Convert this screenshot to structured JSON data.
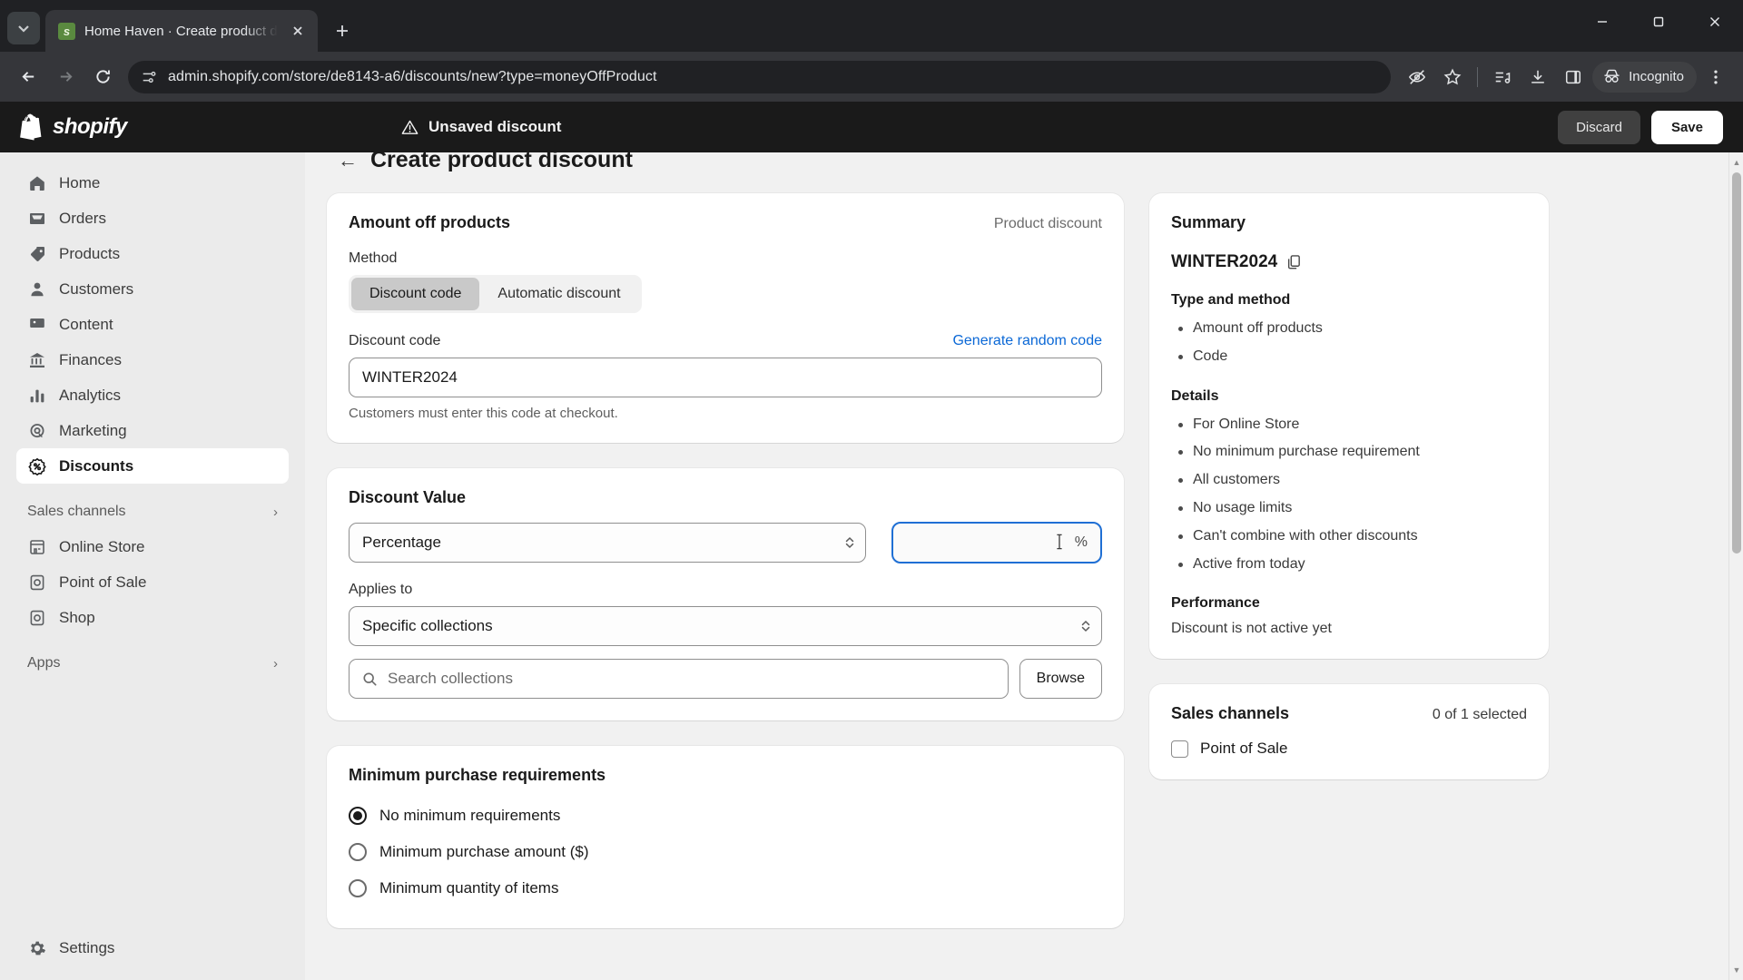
{
  "browser": {
    "tab": {
      "title": "Home Haven · Create product d",
      "favicon_letter": "s"
    },
    "new_tab_label": "+",
    "url": "admin.shopify.com/store/de8143-a6/discounts/new?type=moneyOffProduct",
    "incognito_label": "Incognito",
    "window": {
      "minimize": "–",
      "maximize": "□",
      "close": "✕"
    }
  },
  "shop_header": {
    "brand": "shopify",
    "unsaved_label": "Unsaved discount",
    "discard_label": "Discard",
    "save_label": "Save"
  },
  "sidebar": {
    "items": [
      {
        "label": "Home",
        "icon": "home-icon"
      },
      {
        "label": "Orders",
        "icon": "orders-icon"
      },
      {
        "label": "Products",
        "icon": "products-tag-icon"
      },
      {
        "label": "Customers",
        "icon": "customers-icon"
      },
      {
        "label": "Content",
        "icon": "content-icon"
      },
      {
        "label": "Finances",
        "icon": "finances-bank-icon"
      },
      {
        "label": "Analytics",
        "icon": "analytics-bars-icon"
      },
      {
        "label": "Marketing",
        "icon": "marketing-target-icon"
      },
      {
        "label": "Discounts",
        "icon": "discounts-badge-icon"
      }
    ],
    "sales_channels_group": "Sales channels",
    "sales_channels": [
      {
        "label": "Online Store",
        "icon": "online-store-icon"
      },
      {
        "label": "Point of Sale",
        "icon": "point-of-sale-icon"
      },
      {
        "label": "Shop",
        "icon": "shop-bag-icon"
      }
    ],
    "apps_group": "Apps",
    "settings": {
      "label": "Settings",
      "icon": "gear-icon"
    }
  },
  "page": {
    "title": "Create product discount",
    "back_label": "←"
  },
  "amount_off_card": {
    "title": "Amount off products",
    "badge": "Product discount",
    "method_label": "Method",
    "methods": [
      {
        "label": "Discount code",
        "selected": true
      },
      {
        "label": "Automatic discount",
        "selected": false
      }
    ],
    "code_label": "Discount code",
    "generate_link": "Generate random code",
    "code_value": "WINTER2024",
    "code_placeholder": "",
    "help_text": "Customers must enter this code at checkout."
  },
  "discount_value_card": {
    "title": "Discount Value",
    "type_value": "Percentage",
    "amount_value": "",
    "amount_placeholder": "",
    "percent_suffix": "%",
    "applies_to_label": "Applies to",
    "applies_to_value": "Specific collections",
    "search_placeholder": "Search collections",
    "browse_label": "Browse"
  },
  "minimum_card": {
    "title": "Minimum purchase requirements",
    "options": [
      {
        "label": "No minimum requirements",
        "selected": true
      },
      {
        "label": "Minimum purchase amount ($)",
        "selected": false
      },
      {
        "label": "Minimum quantity of items",
        "selected": false
      }
    ]
  },
  "summary_card": {
    "title": "Summary",
    "code": "WINTER2024",
    "copy_icon": "copy-icon",
    "type_method_title": "Type and method",
    "type_method_items": [
      "Amount off products",
      "Code"
    ],
    "details_title": "Details",
    "details_items": [
      "For Online Store",
      "No minimum purchase requirement",
      "All customers",
      "No usage limits",
      "Can't combine with other discounts",
      "Active from today"
    ],
    "performance_title": "Performance",
    "performance_note": "Discount is not active yet"
  },
  "sales_channels_card": {
    "title": "Sales channels",
    "count_label": "0 of 1 selected",
    "channels": [
      {
        "label": "Point of Sale",
        "checked": false
      }
    ]
  },
  "colors": {
    "accent_blue": "#0b68d6",
    "focus_blue": "#1f6fd4",
    "header_dark": "#1a1a1a",
    "sidebar_bg": "#ebebeb",
    "page_bg": "#f1f1f1"
  }
}
